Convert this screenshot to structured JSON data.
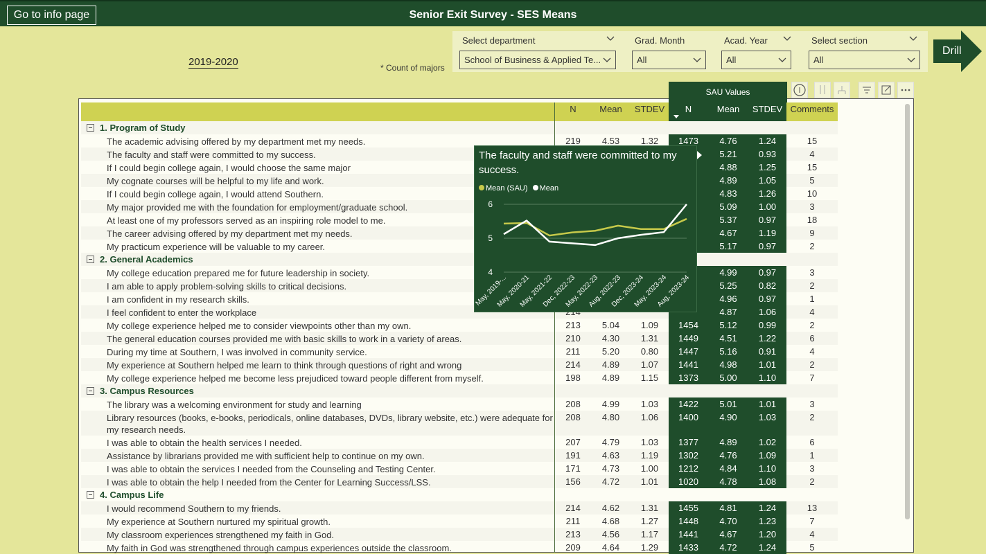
{
  "header": {
    "info_button": "Go to info page",
    "title": "Senior Exit Survey - SES Means"
  },
  "year_label": "2019-2020",
  "count_note": "* Count of majors",
  "slicers": [
    {
      "label": "Select department",
      "value": "School of Business & Applied Te..."
    },
    {
      "label": "Grad. Month",
      "value": "All"
    },
    {
      "label": "Acad. Year",
      "value": "All"
    },
    {
      "label": "Select section",
      "value": "All"
    }
  ],
  "drill_label": "Drill",
  "table": {
    "sau_banner": "SAU Values",
    "columns": [
      "N",
      "Mean",
      "STDEV",
      "N",
      "Mean",
      "STDEV",
      "Comments"
    ],
    "rows": [
      {
        "type": "cat",
        "label": "1. Program of Study"
      },
      {
        "type": "q",
        "label": "The academic advising offered by my department met my needs.",
        "n": "219",
        "mean": "4.53",
        "sd": "1.32",
        "sn": "1473",
        "smean": "4.76",
        "ssd": "1.24",
        "com": "15"
      },
      {
        "type": "q",
        "label": "The faculty and staff were committed to my success.",
        "n": "",
        "mean": "",
        "sd": "",
        "sn": "",
        "smean": "5.21",
        "ssd": "0.93",
        "com": "4"
      },
      {
        "type": "q",
        "label": "If I could begin college again, I would choose the same major",
        "n": "",
        "mean": "",
        "sd": "",
        "sn": "",
        "smean": "4.88",
        "ssd": "1.25",
        "com": "15"
      },
      {
        "type": "q",
        "label": "My cognate courses will be helpful to my life and work.",
        "n": "",
        "mean": "",
        "sd": "",
        "sn": "",
        "smean": "4.89",
        "ssd": "1.05",
        "com": "5"
      },
      {
        "type": "q",
        "label": "If I could begin college again, I would attend Southern.",
        "n": "",
        "mean": "",
        "sd": "",
        "sn": "",
        "smean": "4.83",
        "ssd": "1.26",
        "com": "10"
      },
      {
        "type": "q",
        "label": "My major provided me with the foundation for employment/graduate school.",
        "n": "",
        "mean": "",
        "sd": "",
        "sn": "",
        "smean": "5.09",
        "ssd": "1.00",
        "com": "3"
      },
      {
        "type": "q",
        "label": "At least one of my professors served as an inspiring role model to me.",
        "n": "",
        "mean": "",
        "sd": "",
        "sn": "",
        "smean": "5.37",
        "ssd": "0.97",
        "com": "18"
      },
      {
        "type": "q",
        "label": "The career advising offered by my department met my needs.",
        "n": "",
        "mean": "",
        "sd": "",
        "sn": "",
        "smean": "4.67",
        "ssd": "1.19",
        "com": "9"
      },
      {
        "type": "q",
        "label": "My practicum experience will be valuable to my career.",
        "n": "",
        "mean": "",
        "sd": "",
        "sn": "",
        "smean": "5.17",
        "ssd": "0.97",
        "com": "2"
      },
      {
        "type": "cat",
        "label": "2. General Academics"
      },
      {
        "type": "q",
        "label": "My college education prepared me for future leadership in society.",
        "n": "",
        "mean": "",
        "sd": "",
        "sn": "",
        "smean": "4.99",
        "ssd": "0.97",
        "com": "3"
      },
      {
        "type": "q",
        "label": "I am able to apply problem-solving skills to critical decisions.",
        "n": "",
        "mean": "",
        "sd": "",
        "sn": "",
        "smean": "5.25",
        "ssd": "0.82",
        "com": "2"
      },
      {
        "type": "q",
        "label": "I am confident in my research skills.",
        "n": "",
        "mean": "",
        "sd": "",
        "sn": "",
        "smean": "4.96",
        "ssd": "0.97",
        "com": "1"
      },
      {
        "type": "q",
        "label": "I feel confident to enter the workplace",
        "n": "214",
        "mean": "",
        "sd": "",
        "sn": "",
        "smean": "4.87",
        "ssd": "1.06",
        "com": "4"
      },
      {
        "type": "q",
        "label": "My college experience helped me to consider viewpoints other than my own.",
        "n": "213",
        "mean": "5.04",
        "sd": "1.09",
        "sn": "1454",
        "smean": "5.12",
        "ssd": "0.99",
        "com": "2"
      },
      {
        "type": "q",
        "label": "The general education courses provided me with basic skills to work in a variety of areas.",
        "n": "210",
        "mean": "4.30",
        "sd": "1.31",
        "sn": "1449",
        "smean": "4.51",
        "ssd": "1.22",
        "com": "6"
      },
      {
        "type": "q",
        "label": "During my time at Southern, I was involved in community service.",
        "n": "211",
        "mean": "5.20",
        "sd": "0.80",
        "sn": "1447",
        "smean": "5.16",
        "ssd": "0.91",
        "com": "4"
      },
      {
        "type": "q",
        "label": "My experience at Southern helped me learn to think through questions of right and wrong",
        "n": "214",
        "mean": "4.89",
        "sd": "1.07",
        "sn": "1441",
        "smean": "4.98",
        "ssd": "1.01",
        "com": "2"
      },
      {
        "type": "q",
        "label": "My college experience helped me become less prejudiced toward people different from myself.",
        "n": "198",
        "mean": "4.89",
        "sd": "1.15",
        "sn": "1373",
        "smean": "5.00",
        "ssd": "1.10",
        "com": "7"
      },
      {
        "type": "cat",
        "label": "3. Campus Resources"
      },
      {
        "type": "q",
        "label": "The library was a welcoming environment for study and learning",
        "n": "208",
        "mean": "4.99",
        "sd": "1.03",
        "sn": "1422",
        "smean": "5.01",
        "ssd": "1.01",
        "com": "3"
      },
      {
        "type": "q2",
        "label": "Library resources (books, e-books, periodicals, online databases, DVDs, library website, etc.) were adequate for my research needs.",
        "n": "208",
        "mean": "4.80",
        "sd": "1.06",
        "sn": "1400",
        "smean": "4.90",
        "ssd": "1.03",
        "com": "2"
      },
      {
        "type": "q",
        "label": "I was able to obtain the health services I needed.",
        "n": "207",
        "mean": "4.79",
        "sd": "1.03",
        "sn": "1377",
        "smean": "4.89",
        "ssd": "1.02",
        "com": "6"
      },
      {
        "type": "q",
        "label": "Assistance by librarians provided me with sufficient help to continue on my own.",
        "n": "191",
        "mean": "4.63",
        "sd": "1.19",
        "sn": "1302",
        "smean": "4.76",
        "ssd": "1.09",
        "com": "1"
      },
      {
        "type": "q",
        "label": "I was able to obtain the services I needed from the Counseling and Testing Center.",
        "n": "171",
        "mean": "4.73",
        "sd": "1.00",
        "sn": "1212",
        "smean": "4.84",
        "ssd": "1.10",
        "com": "3"
      },
      {
        "type": "q",
        "label": "I was able to obtain the help I needed from the Center for Learning Success/LSS.",
        "n": "156",
        "mean": "4.72",
        "sd": "1.01",
        "sn": "1020",
        "smean": "4.78",
        "ssd": "1.08",
        "com": "2"
      },
      {
        "type": "cat",
        "label": "4. Campus Life"
      },
      {
        "type": "q",
        "label": "I would recommend Southern to my friends.",
        "n": "214",
        "mean": "4.62",
        "sd": "1.31",
        "sn": "1455",
        "smean": "4.81",
        "ssd": "1.24",
        "com": "13"
      },
      {
        "type": "q",
        "label": "My experience at Southern nurtured my spiritual growth.",
        "n": "211",
        "mean": "4.68",
        "sd": "1.27",
        "sn": "1448",
        "smean": "4.70",
        "ssd": "1.23",
        "com": "7"
      },
      {
        "type": "q",
        "label": "My classroom experiences strengthened my faith in God.",
        "n": "213",
        "mean": "4.56",
        "sd": "1.17",
        "sn": "1441",
        "smean": "4.67",
        "ssd": "1.20",
        "com": "4"
      },
      {
        "type": "q",
        "label": "My faith in God was strengthened through campus experiences outside the classroom.",
        "n": "209",
        "mean": "4.64",
        "sd": "1.29",
        "sn": "1433",
        "smean": "4.72",
        "ssd": "1.24",
        "com": "5"
      }
    ]
  },
  "tooltip": {
    "title": "The faculty and staff were committed to my success.",
    "legend": [
      "Mean (SAU)",
      "Mean"
    ],
    "colors": {
      "sau": "#c6c94a",
      "mean": "#ffffff",
      "bg": "#1f4d2b"
    }
  },
  "chart_data": {
    "type": "line",
    "title": "The faculty and staff were committed to my success.",
    "x": [
      "May, 2019-...",
      "May, 2020-21",
      "May, 2021-22",
      "Dec, 2022-23",
      "May, 2022-23",
      "Aug, 2022-23",
      "Dec, 2023-24",
      "May, 2023-24",
      "Aug, 2023-24"
    ],
    "series": [
      {
        "name": "Mean (SAU)",
        "values": [
          5.43,
          5.45,
          5.08,
          5.17,
          5.22,
          5.37,
          5.27,
          5.27,
          5.57
        ]
      },
      {
        "name": "Mean",
        "values": [
          5.12,
          5.52,
          4.9,
          4.85,
          4.8,
          5.0,
          5.1,
          5.18,
          6.0
        ]
      }
    ],
    "ylim": [
      4,
      6
    ],
    "yticks": [
      4,
      5,
      6
    ]
  }
}
